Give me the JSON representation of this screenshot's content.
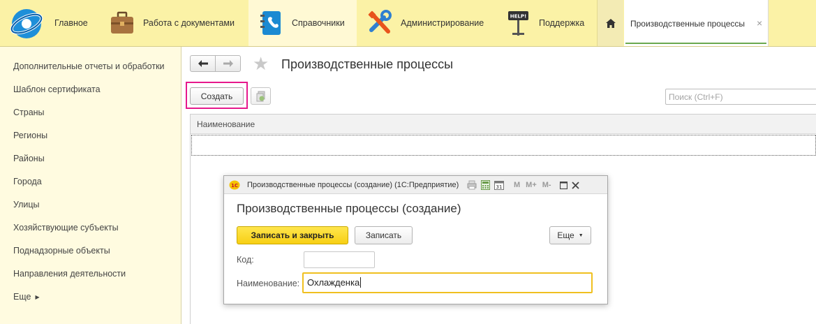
{
  "sections": [
    {
      "label": "Главное",
      "icon": "house-icon"
    },
    {
      "label": "Работа с документами",
      "icon": "briefcase-icon"
    },
    {
      "label": "Справочники",
      "icon": "address-book-icon",
      "active": true
    },
    {
      "label": "Администрирование",
      "icon": "tools-icon"
    },
    {
      "label": "Поддержка",
      "icon": "help-sign-icon"
    }
  ],
  "open_tab": {
    "label": "Производственные процессы",
    "close": "×"
  },
  "nav_panel": {
    "items": [
      "Дополнительные отчеты и обработки",
      "Шаблон сертификата",
      "Страны",
      "Регионы",
      "Районы",
      "Города",
      "Улицы",
      "Хозяйствующие субъекты",
      "Поднадзорные объекты",
      "Направления деятельности"
    ],
    "more": "Еще"
  },
  "list_form": {
    "title": "Производственные процессы",
    "create_button": "Создать",
    "search_placeholder": "Поиск (Ctrl+F)",
    "column_header": "Наименование"
  },
  "dialog": {
    "caption": "Производственные процессы (создание)  (1С:Предприятие)",
    "title": "Производственные процессы (создание)",
    "save_close_button": "Записать и закрыть",
    "save_button": "Записать",
    "more_button": "Еще",
    "memory_buttons": [
      "M",
      "M+",
      "M-"
    ],
    "code_label": "Код:",
    "code_value": "",
    "name_label": "Наименование:",
    "name_value": "Охлажденка"
  },
  "colors": {
    "top_bar": "#fbf2a6",
    "nav_panel": "#fffbe0",
    "highlight": "#e6198c",
    "primary_button": "#f7cf14",
    "active_field_border": "#f0c020"
  }
}
